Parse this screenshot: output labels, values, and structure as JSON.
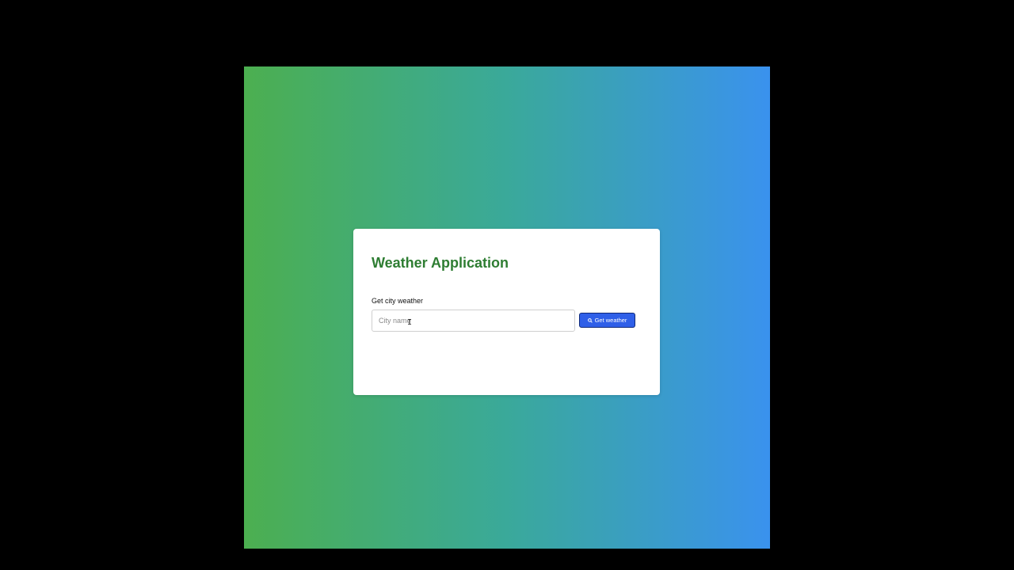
{
  "app": {
    "title": "Weather Application"
  },
  "form": {
    "label": "Get city weather",
    "city_input": {
      "value": "",
      "placeholder": "City name"
    },
    "submit_button": {
      "label": "Get weather",
      "icon": "search-icon"
    }
  },
  "colors": {
    "gradient_start": "#4caf50",
    "gradient_end": "#3a92ee",
    "title": "#2e7d32",
    "button": "#2f5fe8"
  }
}
